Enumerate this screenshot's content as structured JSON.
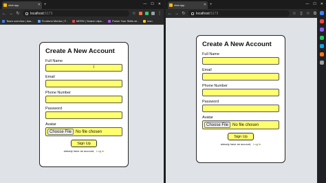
{
  "left_window": {
    "tab_title": "chat app",
    "url_host": "localhost",
    "url_port": ":5173",
    "bookmarks": [
      "Team overview | das...",
      "Frontend Mentor | F...",
      "MERN | Search clips...",
      "Power Your Skills wi...",
      "icon"
    ]
  },
  "right_window": {
    "tab_title": "chat app",
    "url_host": "localhost",
    "url_port": ":5173"
  },
  "form": {
    "title": "Create A New Account",
    "full_name_label": "Full Name",
    "email_label": "Email",
    "phone_label": "Phone Number",
    "password_label": "Password",
    "avatar_label": "Avatar",
    "choose_file": "Choose File",
    "no_file": "No file chosen",
    "submit": "Sign Up",
    "login_prompt": "already have an account,",
    "login_link": "Log In"
  },
  "colors": {
    "field_bg": "#ffff6e",
    "page_bg": "#dfe3e7",
    "link": "#5a6b00"
  }
}
